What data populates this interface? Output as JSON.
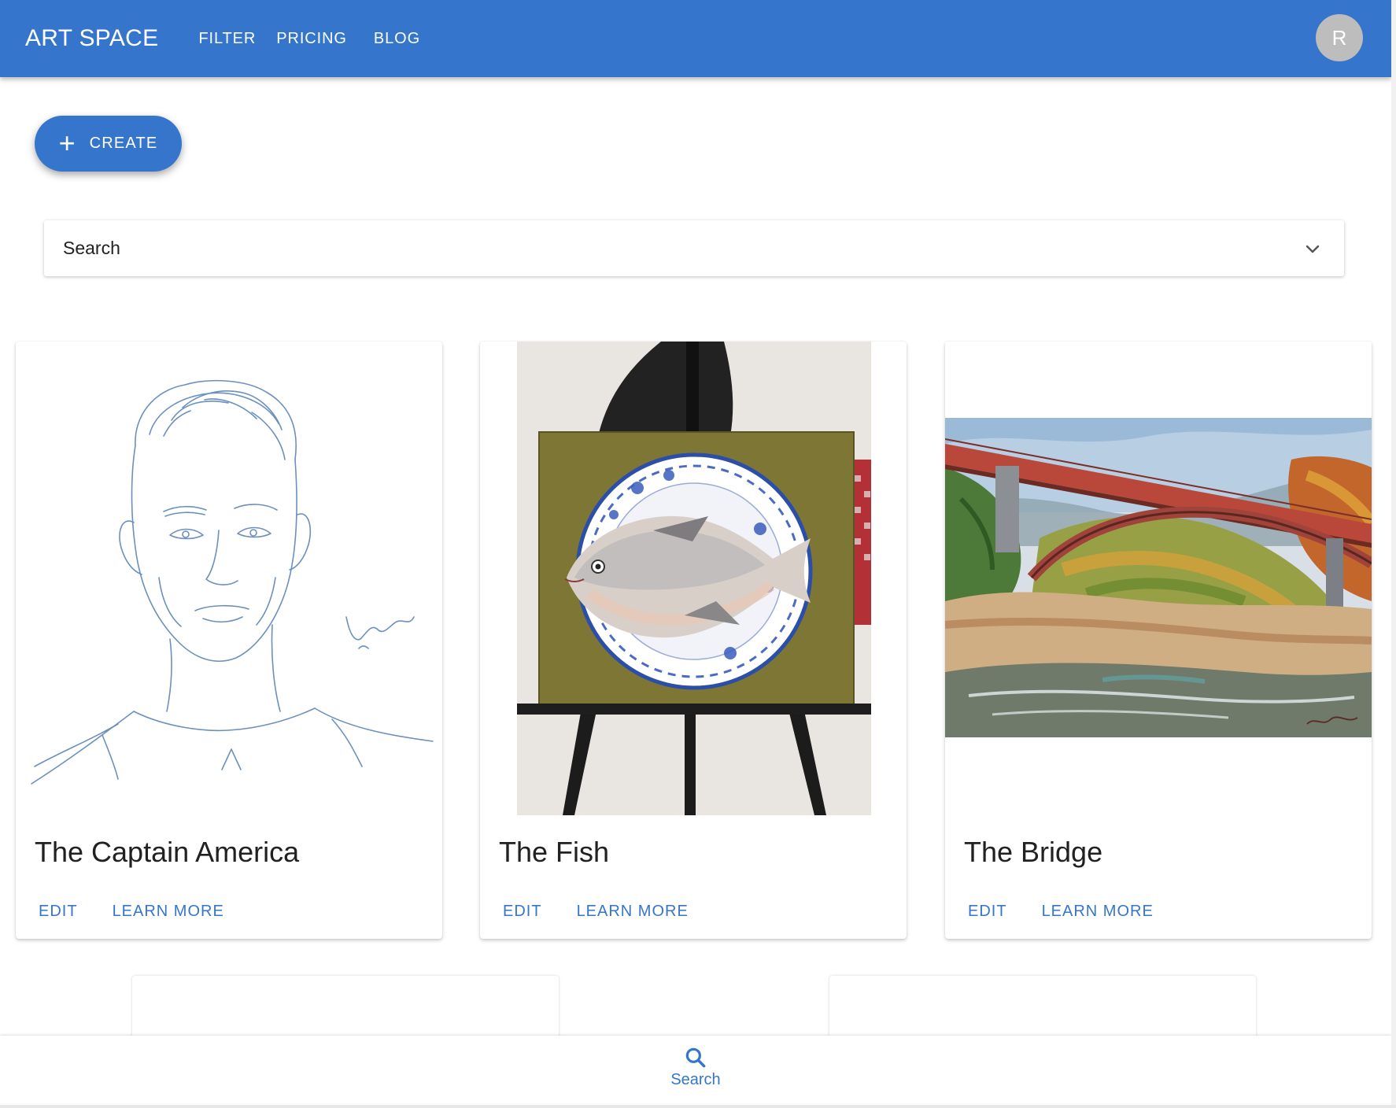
{
  "header": {
    "brand": "ART SPACE",
    "nav": [
      {
        "label": "FILTER"
      },
      {
        "label": "PRICING"
      },
      {
        "label": "BLOG"
      }
    ],
    "avatar_initial": "R"
  },
  "create_button": {
    "label": "CREATE",
    "icon": "plus-icon"
  },
  "search_panel": {
    "label": "Search",
    "icon": "chevron-down-icon"
  },
  "cards": [
    {
      "title": "The Captain America",
      "edit_label": "EDIT",
      "learn_label": "LEARN MORE"
    },
    {
      "title": "The Fish",
      "edit_label": "EDIT",
      "learn_label": "LEARN MORE"
    },
    {
      "title": "The Bridge",
      "edit_label": "EDIT",
      "learn_label": "LEARN MORE"
    }
  ],
  "bottom_nav": {
    "label": "Search",
    "icon": "search-icon"
  },
  "colors": {
    "primary": "#3675cc",
    "avatar_bg": "#bdbdbd",
    "text": "#212121"
  }
}
